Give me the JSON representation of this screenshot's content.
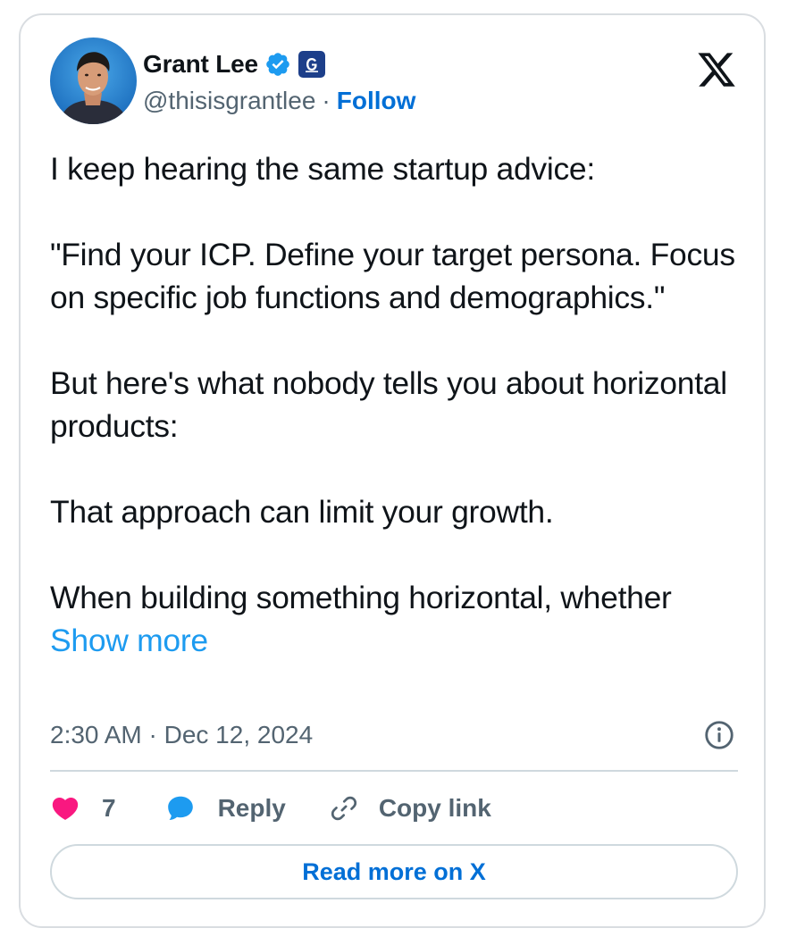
{
  "author": {
    "name": "Grant Lee",
    "handle": "@thisisgrantlee",
    "separator": "·",
    "follow_label": "Follow",
    "verified_icon": "verified-badge-icon",
    "affiliation_icon": "gamma-affiliation-icon",
    "affiliation_letter": "G"
  },
  "tweet": {
    "lines": [
      "I keep hearing the same startup advice:",
      "\"Find your ICP. Define your target persona. Focus on specific job functions and demographics.\"",
      "But here's what nobody tells you about horizontal products:",
      "That approach can limit your growth.",
      "When building something horizontal, whether"
    ],
    "show_more": "Show more"
  },
  "meta": {
    "timestamp": "2:30 AM · Dec 12, 2024"
  },
  "actions": {
    "like_count": "7",
    "reply_label": "Reply",
    "copy_label": "Copy link"
  },
  "footer": {
    "read_more_label": "Read more on X"
  },
  "colors": {
    "text": "#0f1419",
    "secondary": "#536471",
    "link": "#1d9bf0",
    "follow": "#006fd6",
    "like": "#f91880",
    "border": "#cfd9de"
  }
}
